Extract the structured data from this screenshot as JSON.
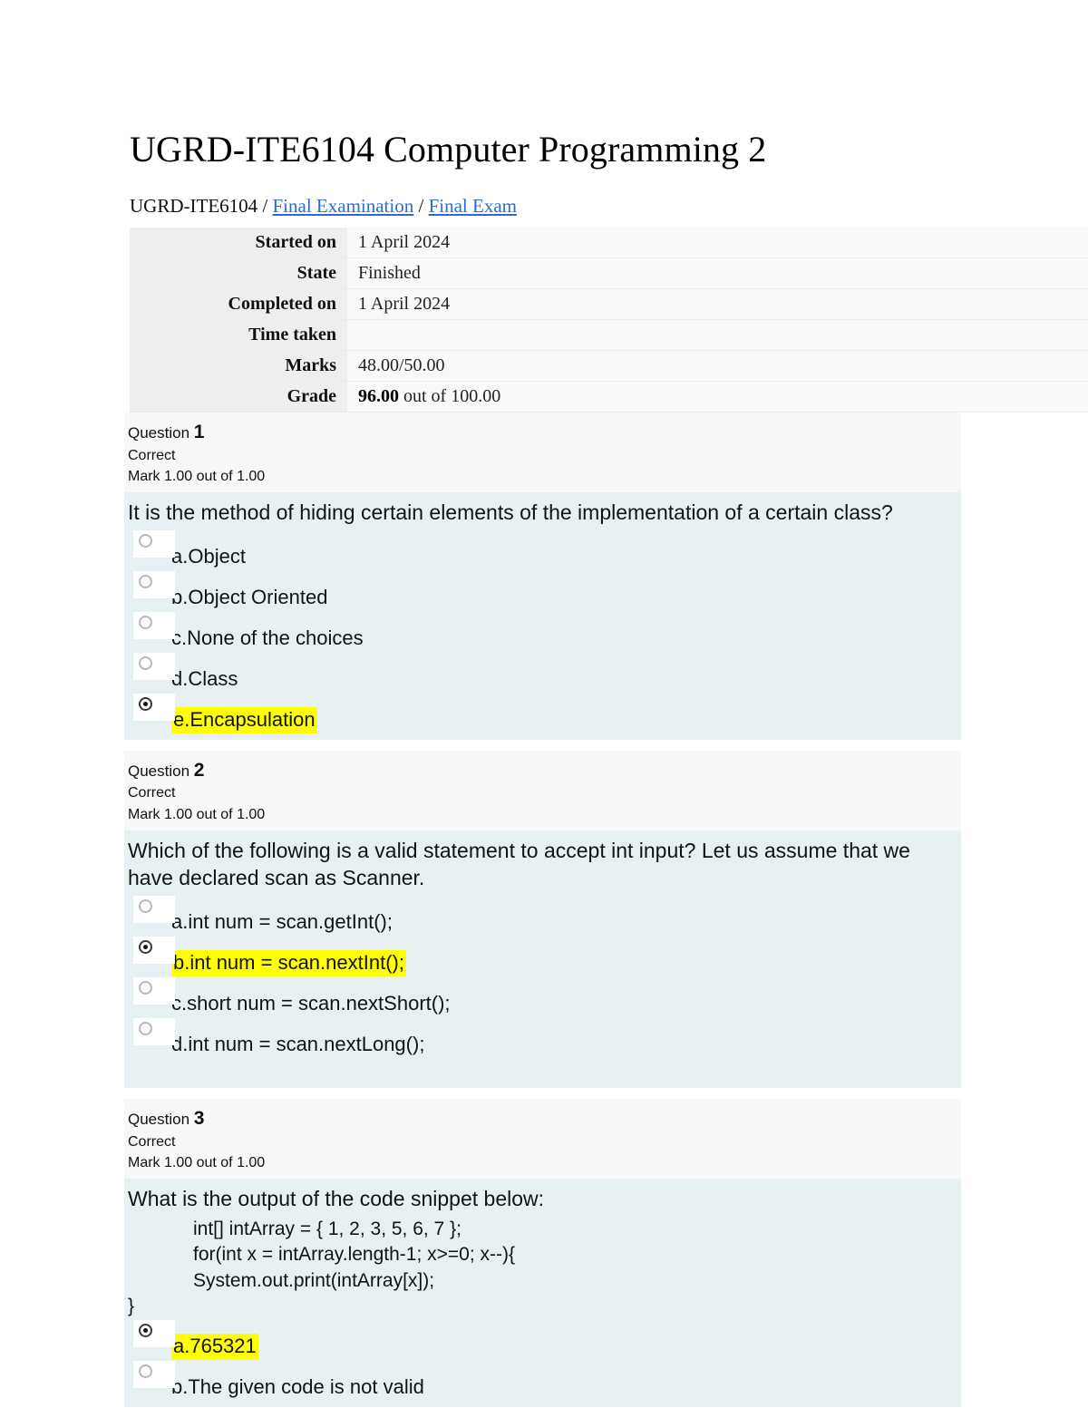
{
  "page_title": "UGRD-ITE6104 Computer Programming 2",
  "breadcrumb": {
    "root": "UGRD-ITE6104",
    "sep": "/",
    "link1": "Final Examination",
    "link2": "Final Exam",
    "link_color": "#2b6cd4"
  },
  "info": {
    "rows": [
      {
        "label": "Started on",
        "value": "1 April 2024"
      },
      {
        "label": "State",
        "value": "Finished"
      },
      {
        "label": "Completed on",
        "value": "1 April 2024"
      },
      {
        "label": "Time taken",
        "value": ""
      },
      {
        "label": "Marks",
        "value": "48.00/50.00"
      }
    ],
    "grade_label": "Grade",
    "grade_value": "96.00",
    "grade_suffix": " out of 100.00"
  },
  "colors": {
    "highlight": "#ffff00",
    "question_header_bg": "#f7f8fa",
    "question_body_bg": "#e7f1f3",
    "table_label_bg": "#eeeeee",
    "table_value_bg": "#f9f9f9"
  },
  "questions": [
    {
      "number_label": "Question",
      "number": "1",
      "state": "Correct",
      "mark": "Mark 1.00 out of 1.00",
      "text": "It is the method of hiding certain elements of the implementation of a certain class?",
      "options": [
        {
          "label": "a.Object",
          "selected": false,
          "highlighted": false
        },
        {
          "label": "b.Object Oriented",
          "selected": false,
          "highlighted": false
        },
        {
          "label": "c.None of the choices",
          "selected": false,
          "highlighted": false
        },
        {
          "label": "d.Class",
          "selected": false,
          "highlighted": false
        },
        {
          "label": "e.Encapsulation",
          "selected": true,
          "highlighted": true
        }
      ]
    },
    {
      "number_label": "Question",
      "number": "2",
      "state": "Correct",
      "mark": "Mark 1.00 out of 1.00",
      "text": "Which of the following is a valid statement to accept int input? Let us assume that we have declared scan as Scanner.",
      "options": [
        {
          "label": "a.int num = scan.getInt();",
          "selected": false,
          "highlighted": false
        },
        {
          "label": "b.int num = scan.nextInt();",
          "selected": true,
          "highlighted": true
        },
        {
          "label": "c.short num = scan.nextShort();",
          "selected": false,
          "highlighted": false
        },
        {
          "label": "d.int num = scan.nextLong();",
          "selected": false,
          "highlighted": false
        }
      ]
    },
    {
      "number_label": "Question",
      "number": "3",
      "state": "Correct",
      "mark": "Mark 1.00 out of 1.00",
      "text": "What is the output of the code snippet below:",
      "code_lines": [
        {
          "text": "int[] intArray = { 1, 2, 3, 5, 6, 7 };",
          "indented": true
        },
        {
          "text": "for(int x = intArray.length-1; x>=0; x--){",
          "indented": true
        },
        {
          "text": "System.out.print(intArray[x]);",
          "indented": true
        },
        {
          "text": "}",
          "indented": false
        }
      ],
      "options": [
        {
          "label": "a.765321",
          "selected": true,
          "highlighted": true
        },
        {
          "label": "b.The given code is not valid",
          "selected": false,
          "highlighted": false
        }
      ]
    }
  ]
}
